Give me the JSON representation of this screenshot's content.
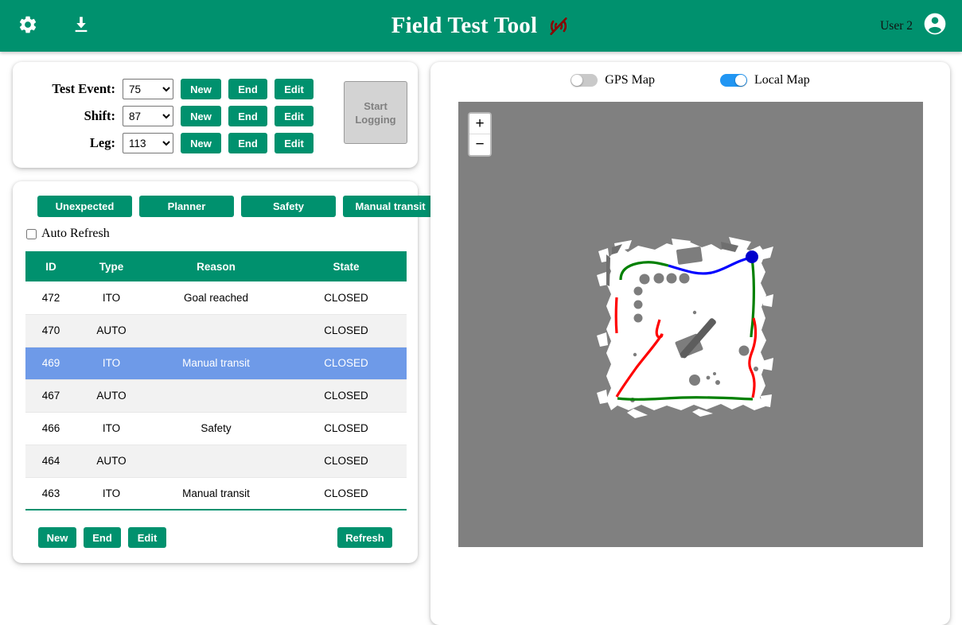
{
  "header": {
    "title": "Field Test Tool",
    "settings_icon": "gear-icon",
    "download_icon": "download-icon",
    "connection_icon": "wifi-off-icon",
    "connection_color": "#8b0000",
    "user_name": "User 2",
    "account_icon": "account-circle-icon",
    "background_color": "#00916e"
  },
  "session": {
    "rows": [
      {
        "label": "Test Event:",
        "value": "75",
        "new_label": "New",
        "end_label": "End",
        "edit_label": "Edit"
      },
      {
        "label": "Shift:",
        "value": "87",
        "new_label": "New",
        "end_label": "End",
        "edit_label": "Edit"
      },
      {
        "label": "Leg:",
        "value": "113",
        "new_label": "New",
        "end_label": "End",
        "edit_label": "Edit"
      }
    ],
    "start_logging_label": "Start\nLogging",
    "start_logging_disabled": true
  },
  "events": {
    "reason_tabs": [
      {
        "label": "Unexpected"
      },
      {
        "label": "Planner"
      },
      {
        "label": "Safety"
      },
      {
        "label": "Manual transit"
      }
    ],
    "auto_refresh_label": "Auto Refresh",
    "auto_refresh_checked": false,
    "columns": [
      "ID",
      "Type",
      "Reason",
      "State"
    ],
    "rows": [
      {
        "id": "472",
        "type": "ITO",
        "reason": "Goal reached",
        "state": "CLOSED",
        "selected": false
      },
      {
        "id": "470",
        "type": "AUTO",
        "reason": "",
        "state": "CLOSED",
        "selected": false
      },
      {
        "id": "469",
        "type": "ITO",
        "reason": "Manual transit",
        "state": "CLOSED",
        "selected": true
      },
      {
        "id": "467",
        "type": "AUTO",
        "reason": "",
        "state": "CLOSED",
        "selected": false
      },
      {
        "id": "466",
        "type": "ITO",
        "reason": "Safety",
        "state": "CLOSED",
        "selected": false
      },
      {
        "id": "464",
        "type": "AUTO",
        "reason": "",
        "state": "CLOSED",
        "selected": false
      },
      {
        "id": "463",
        "type": "ITO",
        "reason": "Manual transit",
        "state": "CLOSED",
        "selected": false
      }
    ],
    "footer": {
      "new_label": "New",
      "end_label": "End",
      "edit_label": "Edit",
      "refresh_label": "Refresh"
    },
    "selected_row_color": "#6e9ae8",
    "header_color": "#00916e"
  },
  "map": {
    "gps_toggle": {
      "label": "GPS Map",
      "on": false
    },
    "local_toggle": {
      "label": "Local Map",
      "on": true
    },
    "zoom_in_label": "+",
    "zoom_out_label": "−",
    "background_color": "#808080",
    "occupancy_color": "#ffffff",
    "path_colors": {
      "auto": "#008000",
      "manual": "#ff0000",
      "ito": "#0000ff"
    },
    "robot_marker_color": "#0000cc"
  }
}
